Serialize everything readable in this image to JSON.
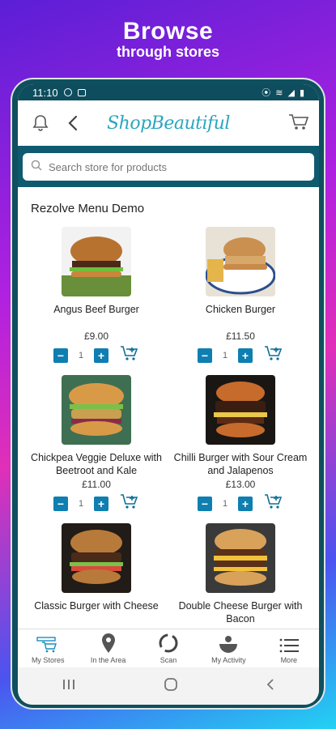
{
  "hero": {
    "title": "Browse",
    "subtitle": "through stores"
  },
  "status": {
    "time": "11:10"
  },
  "app": {
    "brand": "ShopBeautiful"
  },
  "search": {
    "placeholder": "Search store for products"
  },
  "store": {
    "title": "Rezolve Menu Demo"
  },
  "products": [
    {
      "name": "Angus Beef Burger",
      "price": "£9.00",
      "qty": "1"
    },
    {
      "name": "Chicken Burger",
      "price": "£11.50",
      "qty": "1"
    },
    {
      "name": "Chickpea Veggie Deluxe with Beetroot and Kale",
      "price": "£11.00",
      "qty": "1"
    },
    {
      "name": "Chilli Burger with Sour Cream and Jalapenos",
      "price": "£13.00",
      "qty": "1"
    },
    {
      "name": "Classic Burger with Cheese",
      "price": "",
      "qty": ""
    },
    {
      "name": "Double Cheese Burger with Bacon",
      "price": "",
      "qty": ""
    }
  ],
  "nav": [
    {
      "label": "My Stores",
      "icon": "store-cart-icon"
    },
    {
      "label": "In the Area",
      "icon": "location-pin-icon"
    },
    {
      "label": "Scan",
      "icon": "scan-icon"
    },
    {
      "label": "My Activity",
      "icon": "activity-icon"
    },
    {
      "label": "More",
      "icon": "menu-list-icon"
    }
  ],
  "colors": {
    "accent": "#0e7fb0",
    "header": "#0f5a6e",
    "brand": "#2aa6bf"
  }
}
